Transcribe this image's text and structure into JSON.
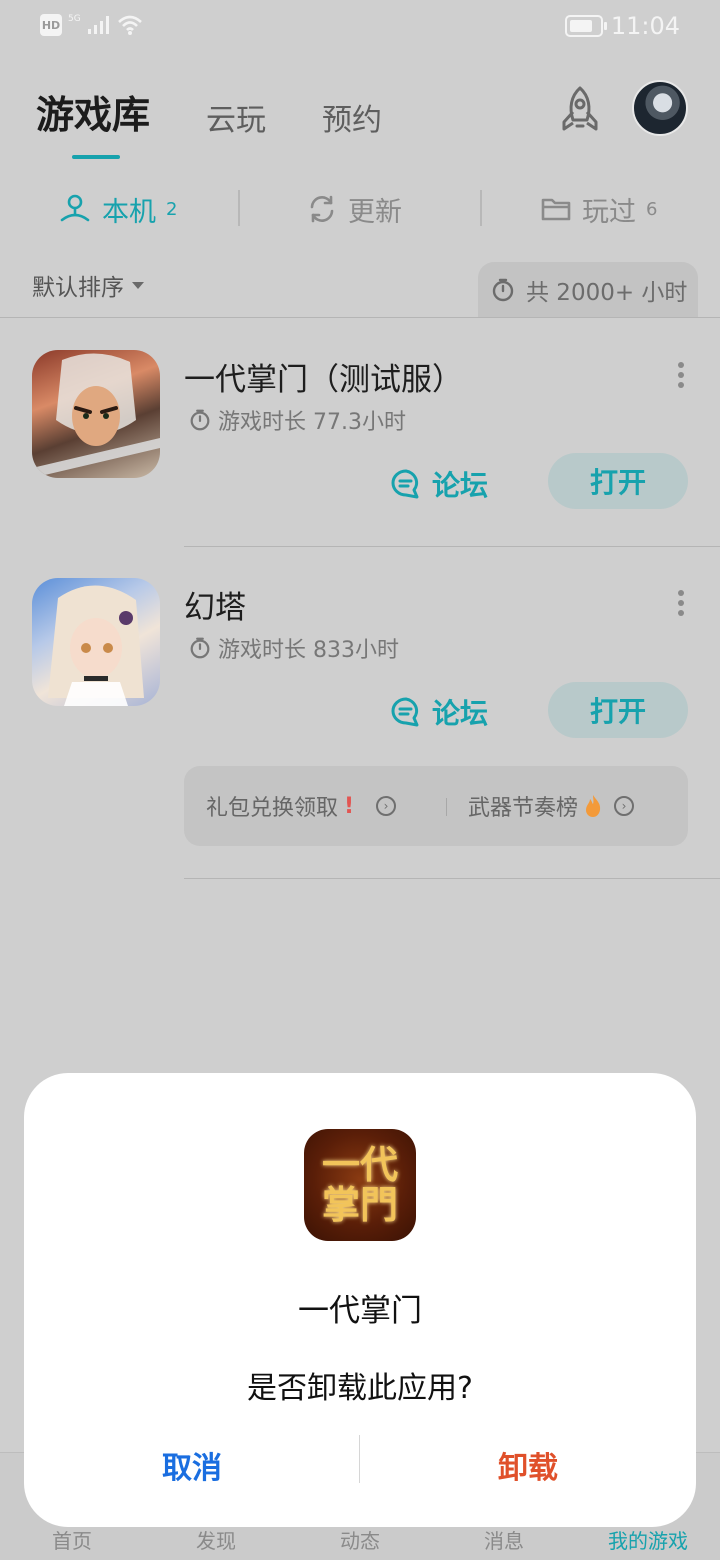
{
  "status_bar": {
    "time": "11:04",
    "hd_label": "HD",
    "network_label": "5G"
  },
  "header": {
    "tabs": [
      "游戏库",
      "云玩",
      "预约"
    ]
  },
  "segments": {
    "local": {
      "label": "本机",
      "count": "2"
    },
    "update": {
      "label": "更新"
    },
    "played": {
      "label": "玩过",
      "count": "6"
    }
  },
  "sort": {
    "label": "默认排序"
  },
  "total": {
    "label": "共 2000+ 小时"
  },
  "games": [
    {
      "title": "一代掌门（测试服）",
      "time": "游戏时长 77.3小时",
      "forum": "论坛",
      "open": "打开"
    },
    {
      "title": "幻塔",
      "time": "游戏时长 833小时",
      "forum": "论坛",
      "open": "打开"
    }
  ],
  "promo": {
    "item1": "礼包兑换领取",
    "item2": "武器节奏榜"
  },
  "bottom_nav": [
    "首页",
    "发现",
    "动态",
    "消息",
    "我的游戏"
  ],
  "dialog": {
    "logo_text": "一代掌門",
    "title": "一代掌门",
    "message": "是否卸载此应用?",
    "cancel": "取消",
    "confirm": "卸载"
  },
  "colors": {
    "accent": "#17a2ad",
    "cancel": "#1a6ee0",
    "danger": "#e0502a"
  }
}
